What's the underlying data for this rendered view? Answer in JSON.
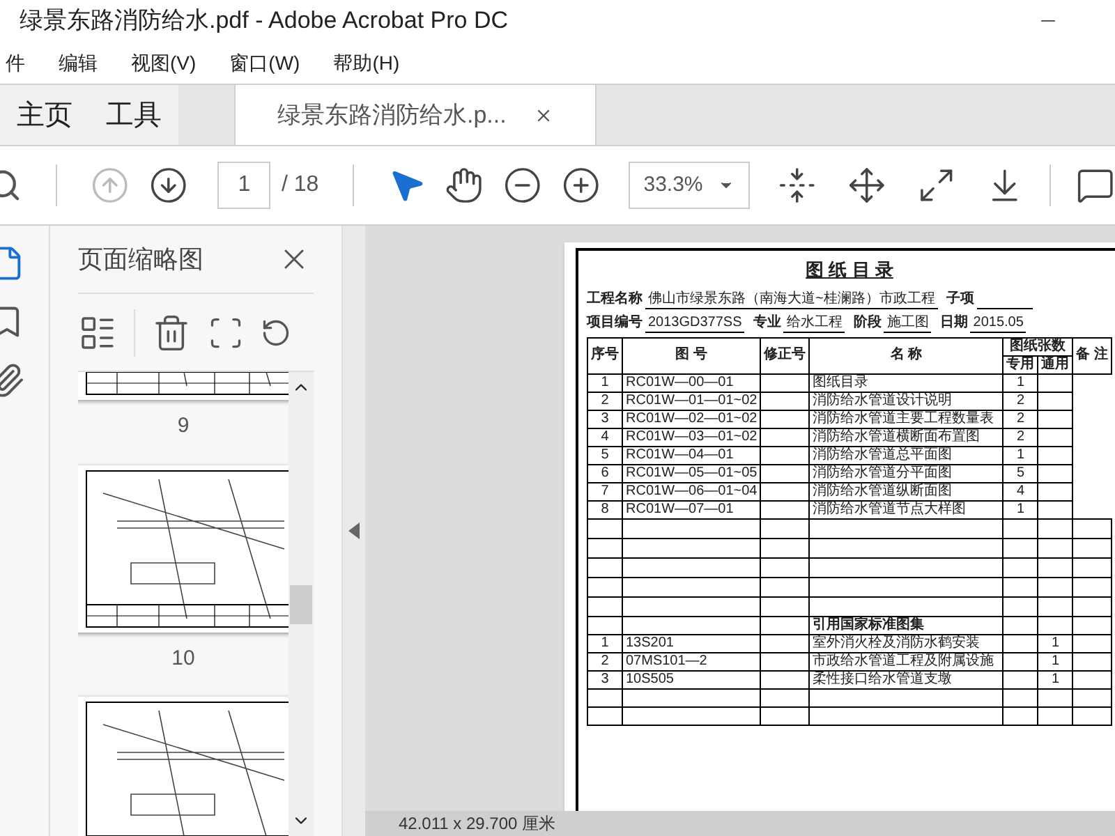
{
  "window": {
    "title": "绿景东路消防给水.pdf - Adobe Acrobat Pro DC"
  },
  "menu": [
    "件",
    "编辑",
    "视图(V)",
    "窗口(W)",
    "帮助(H)"
  ],
  "tabs": [
    {
      "label": "主页",
      "selected": false,
      "kind": "nav"
    },
    {
      "label": "工具",
      "selected": false,
      "kind": "nav"
    },
    {
      "label": "绿景东路消防给水.p...",
      "selected": true,
      "kind": "document"
    }
  ],
  "toolbar": {
    "navigation": [
      {
        "kind": "previous",
        "disabled": true
      },
      {
        "kind": "next",
        "disabled": false
      }
    ],
    "page_number": "1",
    "page_total": "/ 18",
    "tools": [
      {
        "kind": "select",
        "selected": true
      },
      {
        "kind": "hand",
        "selected": false
      }
    ],
    "zoom": "33.3%"
  },
  "nav_panel": [
    {
      "kind": "pages",
      "selected": true
    },
    {
      "kind": "bookmarks",
      "selected": false
    },
    {
      "kind": "attachments",
      "selected": false
    }
  ],
  "sidebar": {
    "title": "页面缩略图",
    "thumbnails": [
      {
        "kind": "page",
        "label": "9"
      },
      {
        "kind": "page",
        "label": "10"
      },
      {
        "kind": "page"
      }
    ]
  },
  "document": {
    "title": "图 纸 目 录",
    "info_rows": [
      [
        {
          "label": "工程名称",
          "value": "佛山市绿景东路（南海大道~桂澜路）市政工程"
        },
        {
          "label": "子项"
        }
      ],
      [
        {
          "label": "项目编号",
          "value": "2013GD377SS"
        },
        {
          "label": "专业",
          "value": "给水工程"
        },
        {
          "label": "阶段",
          "value": "施工图"
        },
        {
          "label": "日期",
          "value": "2015.05"
        }
      ]
    ],
    "columns": [
      "序号",
      "图 号",
      "修正号",
      "名 称",
      "图纸张数",
      "备 注"
    ],
    "sub_columns": [
      "专用",
      "通用"
    ],
    "rows": [
      [
        "1",
        "RC01W—00—01",
        "",
        "图纸目录",
        "1",
        ""
      ],
      [
        "2",
        "RC01W—01—01~02",
        "",
        "消防给水管道设计说明",
        "2",
        ""
      ],
      [
        "3",
        "RC01W—02—01~02",
        "",
        "消防给水管道主要工程数量表",
        "2",
        ""
      ],
      [
        "4",
        "RC01W—03—01~02",
        "",
        "消防给水管道横断面布置图",
        "2",
        ""
      ],
      [
        "5",
        "RC01W—04—01",
        "",
        "消防给水管道总平面图",
        "1",
        ""
      ],
      [
        "6",
        "RC01W—05—01~05",
        "",
        "消防给水管道分平面图",
        "5",
        ""
      ],
      [
        "7",
        "RC01W—06—01~04",
        "",
        "消防给水管道纵断面图",
        "4",
        ""
      ],
      [
        "8",
        "RC01W—07—01",
        "",
        "消防给水管道节点大样图",
        "1",
        ""
      ]
    ],
    "standards_heading": "引用国家标准图集",
    "standard_rows": [
      [
        "1",
        "13S201",
        "",
        "室外消火栓及消防水鹤安装",
        "",
        "1"
      ],
      [
        "2",
        "07MS101—2",
        "",
        "市政给水管道工程及附属设施",
        "",
        "1"
      ],
      [
        "3",
        "10S505",
        "",
        "柔性接口给水管道支墩",
        "",
        "1"
      ]
    ]
  },
  "status_bar": {
    "page_size": "42.011 x 29.700 厘米"
  }
}
